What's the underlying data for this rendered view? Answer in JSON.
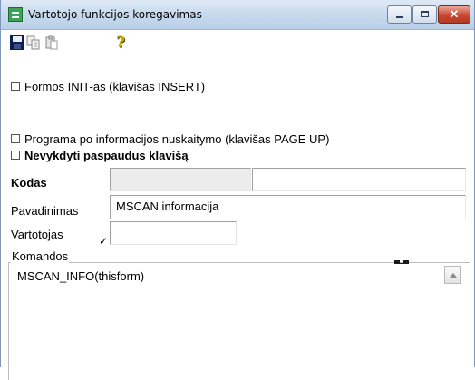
{
  "window": {
    "title": "Vartotojo funkcijos koregavimas",
    "close_glyph": "✕"
  },
  "toolbar": {
    "help_glyph": "?"
  },
  "options": {
    "init_label": "Formos INIT-as (klavišas INSERT)",
    "after_read_label": "Programa po informacijos nuskaitymo (klavišas PAGE UP)",
    "skip_key_label": "Nevykdyti paspaudus klavišą"
  },
  "form": {
    "kodas_label": "Kodas",
    "kodas_value": "",
    "kodas_extra_value": "",
    "pavadinimas_label": "Pavadinimas",
    "pavadinimas_value": "MSCAN informacija",
    "vartotojas_label": "Vartotojas",
    "vartotojas_value": "",
    "vartotojas_mark": "✓"
  },
  "commands": {
    "group_label": "Komandos",
    "text": "MSCAN_INFO(thisform)"
  },
  "colors": {
    "titlebar": "#c9dbee",
    "close_button": "#c9452f"
  }
}
